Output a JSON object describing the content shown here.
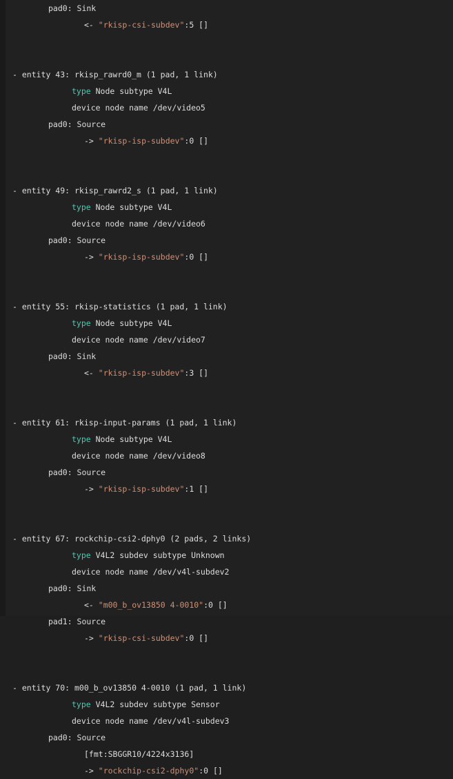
{
  "terminal": {
    "background_color": "#212121",
    "text_color": "#dedede",
    "keyword_color": "#4ec9b0",
    "string_color": "#ce9178",
    "gutter_color": "#1a1a1a"
  },
  "lines": [
    {
      "indent": "pad",
      "segments": [
        {
          "text": "pad0: Sink",
          "style": "txt"
        }
      ]
    },
    {
      "indent": "link",
      "segments": [
        {
          "text": "<- ",
          "style": "txt"
        },
        {
          "text": "\"rkisp-csi-subdev\"",
          "style": "str"
        },
        {
          "text": ":5 []",
          "style": "txt"
        }
      ]
    },
    {
      "indent": "blank",
      "segments": []
    },
    {
      "indent": "blank",
      "segments": []
    },
    {
      "indent": "entity",
      "segments": [
        {
          "text": "- entity 43: rkisp_rawrd0_m (1 pad, 1 link)",
          "style": "txt"
        }
      ]
    },
    {
      "indent": "type",
      "segments": [
        {
          "text": "type",
          "style": "kw"
        },
        {
          "text": " Node subtype V4L",
          "style": "txt"
        }
      ]
    },
    {
      "indent": "type",
      "segments": [
        {
          "text": "device node name /dev/video5",
          "style": "txt"
        }
      ]
    },
    {
      "indent": "pad",
      "segments": [
        {
          "text": "pad0: Source",
          "style": "txt"
        }
      ]
    },
    {
      "indent": "link",
      "segments": [
        {
          "text": "-> ",
          "style": "txt"
        },
        {
          "text": "\"rkisp-isp-subdev\"",
          "style": "str"
        },
        {
          "text": ":0 []",
          "style": "txt"
        }
      ]
    },
    {
      "indent": "blank",
      "segments": []
    },
    {
      "indent": "blank",
      "segments": []
    },
    {
      "indent": "entity",
      "segments": [
        {
          "text": "- entity 49: rkisp_rawrd2_s (1 pad, 1 link)",
          "style": "txt"
        }
      ]
    },
    {
      "indent": "type",
      "segments": [
        {
          "text": "type",
          "style": "kw"
        },
        {
          "text": " Node subtype V4L",
          "style": "txt"
        }
      ]
    },
    {
      "indent": "type",
      "segments": [
        {
          "text": "device node name /dev/video6",
          "style": "txt"
        }
      ]
    },
    {
      "indent": "pad",
      "segments": [
        {
          "text": "pad0: Source",
          "style": "txt"
        }
      ]
    },
    {
      "indent": "link",
      "segments": [
        {
          "text": "-> ",
          "style": "txt"
        },
        {
          "text": "\"rkisp-isp-subdev\"",
          "style": "str"
        },
        {
          "text": ":0 []",
          "style": "txt"
        }
      ]
    },
    {
      "indent": "blank",
      "segments": []
    },
    {
      "indent": "blank",
      "segments": []
    },
    {
      "indent": "entity",
      "segments": [
        {
          "text": "- entity 55: rkisp-statistics (1 pad, 1 link)",
          "style": "txt"
        }
      ]
    },
    {
      "indent": "type",
      "segments": [
        {
          "text": "type",
          "style": "kw"
        },
        {
          "text": " Node subtype V4L",
          "style": "txt"
        }
      ]
    },
    {
      "indent": "type",
      "segments": [
        {
          "text": "device node name /dev/video7",
          "style": "txt"
        }
      ]
    },
    {
      "indent": "pad",
      "segments": [
        {
          "text": "pad0: Sink",
          "style": "txt"
        }
      ]
    },
    {
      "indent": "link",
      "segments": [
        {
          "text": "<- ",
          "style": "txt"
        },
        {
          "text": "\"rkisp-isp-subdev\"",
          "style": "str"
        },
        {
          "text": ":3 []",
          "style": "txt"
        }
      ]
    },
    {
      "indent": "blank",
      "segments": []
    },
    {
      "indent": "blank",
      "segments": []
    },
    {
      "indent": "entity",
      "segments": [
        {
          "text": "- entity 61: rkisp-input-params (1 pad, 1 link)",
          "style": "txt"
        }
      ]
    },
    {
      "indent": "type",
      "segments": [
        {
          "text": "type",
          "style": "kw"
        },
        {
          "text": " Node subtype V4L",
          "style": "txt"
        }
      ]
    },
    {
      "indent": "type",
      "segments": [
        {
          "text": "device node name /dev/video8",
          "style": "txt"
        }
      ]
    },
    {
      "indent": "pad",
      "segments": [
        {
          "text": "pad0: Source",
          "style": "txt"
        }
      ]
    },
    {
      "indent": "link",
      "segments": [
        {
          "text": "-> ",
          "style": "txt"
        },
        {
          "text": "\"rkisp-isp-subdev\"",
          "style": "str"
        },
        {
          "text": ":1 []",
          "style": "txt"
        }
      ]
    },
    {
      "indent": "blank",
      "segments": []
    },
    {
      "indent": "blank",
      "segments": []
    },
    {
      "indent": "entity",
      "segments": [
        {
          "text": "- entity 67: rockchip-csi2-dphy0 (2 pads, 2 links)",
          "style": "txt"
        }
      ]
    },
    {
      "indent": "type",
      "segments": [
        {
          "text": "type",
          "style": "kw"
        },
        {
          "text": " V4L2 subdev subtype Unknown",
          "style": "txt"
        }
      ]
    },
    {
      "indent": "type",
      "segments": [
        {
          "text": "device node name /dev/v4l-subdev2",
          "style": "txt"
        }
      ]
    },
    {
      "indent": "pad",
      "segments": [
        {
          "text": "pad0: Sink",
          "style": "txt"
        }
      ]
    },
    {
      "indent": "link",
      "segments": [
        {
          "text": "<- ",
          "style": "txt"
        },
        {
          "text": "\"m00_b_ov13850 4-0010\"",
          "style": "str"
        },
        {
          "text": ":0 []",
          "style": "txt"
        }
      ]
    },
    {
      "indent": "pad",
      "segments": [
        {
          "text": "pad1: Source",
          "style": "txt"
        }
      ]
    },
    {
      "indent": "link",
      "segments": [
        {
          "text": "-> ",
          "style": "txt"
        },
        {
          "text": "\"rkisp-csi-subdev\"",
          "style": "str"
        },
        {
          "text": ":0 []",
          "style": "txt"
        }
      ]
    },
    {
      "indent": "blank",
      "segments": []
    },
    {
      "indent": "blank",
      "segments": []
    },
    {
      "indent": "entity",
      "segments": [
        {
          "text": "- entity 70: m00_b_ov13850 4-0010 (1 pad, 1 link)",
          "style": "txt"
        }
      ]
    },
    {
      "indent": "type",
      "segments": [
        {
          "text": "type",
          "style": "kw"
        },
        {
          "text": " V4L2 subdev subtype Sensor",
          "style": "txt"
        }
      ]
    },
    {
      "indent": "type",
      "segments": [
        {
          "text": "device node name /dev/v4l-subdev3",
          "style": "txt"
        }
      ]
    },
    {
      "indent": "pad",
      "segments": [
        {
          "text": "pad0: Source",
          "style": "txt"
        }
      ]
    },
    {
      "indent": "link",
      "segments": [
        {
          "text": "[fmt:SBGGR10/4224x3136]",
          "style": "txt"
        }
      ]
    },
    {
      "indent": "link",
      "segments": [
        {
          "text": "-> ",
          "style": "txt"
        },
        {
          "text": "\"rockchip-csi2-dphy0\"",
          "style": "str"
        },
        {
          "text": ":0 []",
          "style": "txt"
        }
      ]
    }
  ]
}
